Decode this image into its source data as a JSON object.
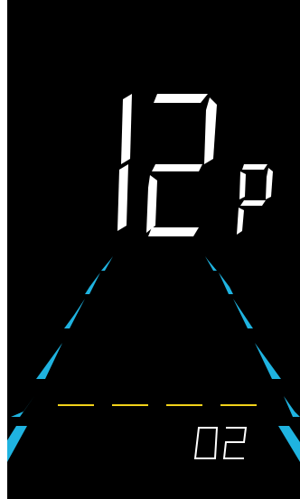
{
  "display": {
    "main_value": "12",
    "unit_label": "P",
    "gear_value": "02"
  },
  "colors": {
    "background": "#000000",
    "digits": "#ffffff",
    "lane_stripes": "#1fb3e0",
    "lane_thin": "#1fb3e0",
    "yellow_line": "#f2d21a"
  }
}
